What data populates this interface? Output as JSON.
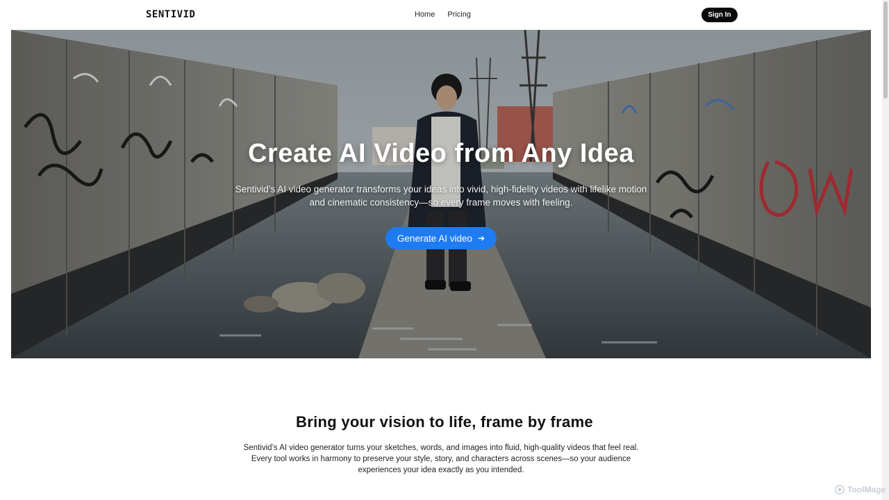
{
  "header": {
    "logo_text": "SENTIVID",
    "nav": [
      {
        "label": "Home"
      },
      {
        "label": "Pricing"
      }
    ],
    "signin_label": "Sign In"
  },
  "hero": {
    "title": "Create AI Video from Any Idea",
    "subtitle": "Sentivid’s AI video generator transforms your ideas into vivid, high-fidelity videos with lifelike motion and cinematic consistency—so every frame moves with feeling.",
    "cta_label": "Generate AI video",
    "cta_icon": "arrow-right-icon"
  },
  "section": {
    "title": "Bring your vision to life, frame by frame",
    "body": "Sentivid’s AI video generator turns your sketches, words, and images into fluid, high-quality videos that feel real. Every tool works in harmony to preserve your style, story, and characters across scenes—so your audience experiences your idea exactly as you intended."
  },
  "watermark": {
    "text": "ToolMage"
  },
  "colors": {
    "accent": "#1e7bf2",
    "signin_bg": "#0b0b0b",
    "graffiti_red": "#c0343a"
  }
}
